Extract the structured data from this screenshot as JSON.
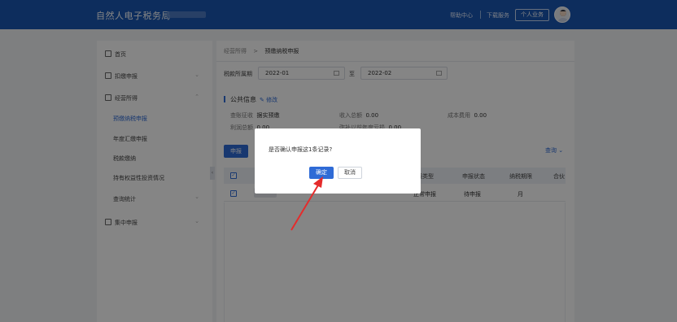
{
  "header": {
    "brand": "自然人电子税务局",
    "help": "帮助中心",
    "download": "下载服务",
    "personal_business": "个人业务"
  },
  "sidebar": {
    "home": "首页",
    "withholding": "扣缴申报",
    "business_income": "经营所得",
    "sub_items": [
      "预缴纳税申报",
      "年度汇缴申报",
      "税款缴纳",
      "持有权益性投资情况",
      "查询统计"
    ],
    "batch": "集中申报"
  },
  "breadcrumb": {
    "parent": "经营所得",
    "separator": ">",
    "current": "预缴纳税申报"
  },
  "filter": {
    "period_label": "税款所属期",
    "start": "2022-01",
    "to": "至",
    "end": "2022-02"
  },
  "public_info": {
    "title": "公共信息",
    "edit": "修改",
    "levy_label": "查账征收",
    "levy_value": "据实预缴",
    "income_label": "收入总额",
    "income_value": "0.00",
    "cost_label": "成本费用",
    "cost_value": "0.00",
    "profit_label": "利润总额",
    "profit_value": "0.00",
    "prior_loss_label": "弥补以前年度亏损",
    "prior_loss_value": "0.00"
  },
  "toolbar": {
    "declare": "申报",
    "query": "查询"
  },
  "table": {
    "headers": [
      "报类型",
      "申报状态",
      "纳税期限",
      "合伙"
    ],
    "row": {
      "type": "正常申报",
      "status": "待申报",
      "period": "月"
    }
  },
  "dialog": {
    "message": "是否确认申报这1条记录?",
    "confirm": "确定",
    "cancel": "取消"
  },
  "colors": {
    "header": "#1a56b3",
    "primary": "#2f6bd6",
    "annotation_arrow": "#e52b2b"
  }
}
